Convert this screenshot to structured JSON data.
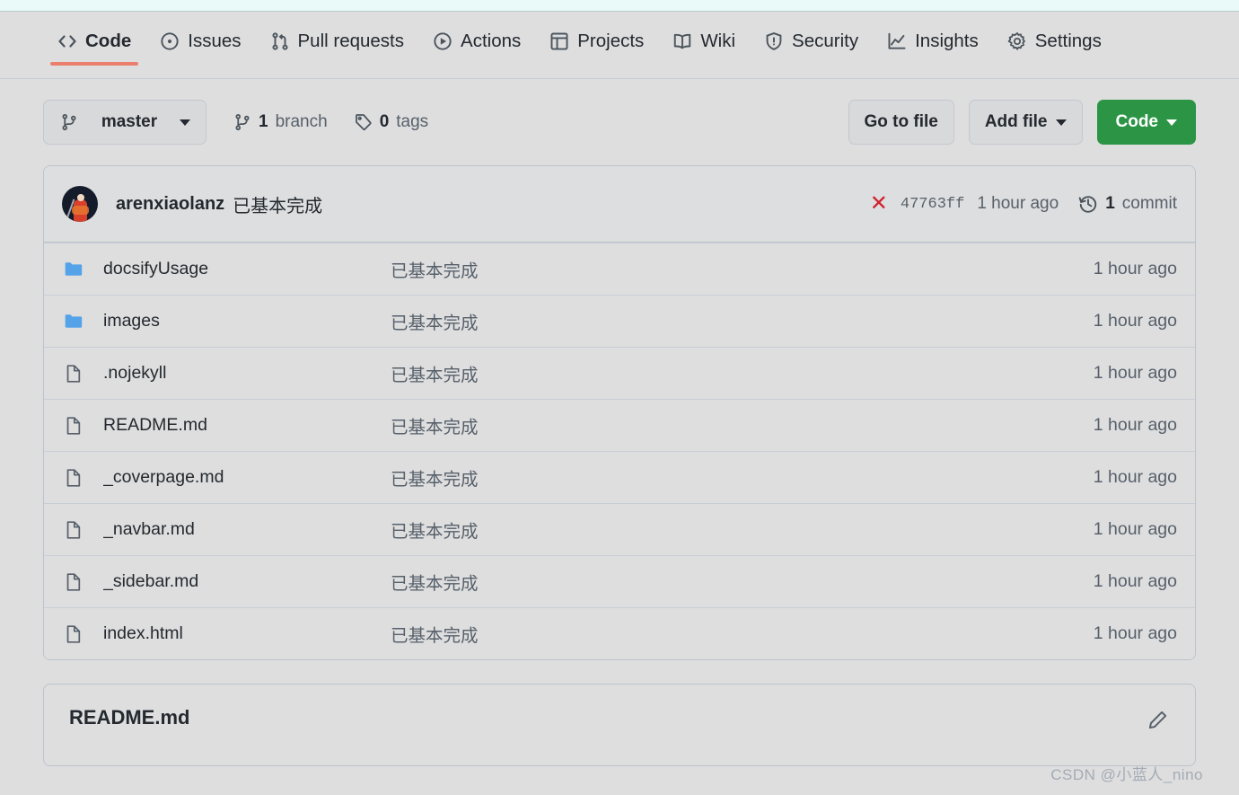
{
  "nav": {
    "items": [
      {
        "label": "Code",
        "icon": "code-icon",
        "active": true
      },
      {
        "label": "Issues",
        "icon": "issue-icon",
        "active": false
      },
      {
        "label": "Pull requests",
        "icon": "pr-icon",
        "active": false
      },
      {
        "label": "Actions",
        "icon": "play-icon",
        "active": false
      },
      {
        "label": "Projects",
        "icon": "table-icon",
        "active": false
      },
      {
        "label": "Wiki",
        "icon": "book-icon",
        "active": false
      },
      {
        "label": "Security",
        "icon": "shield-icon",
        "active": false
      },
      {
        "label": "Insights",
        "icon": "graph-icon",
        "active": false
      },
      {
        "label": "Settings",
        "icon": "gear-icon",
        "active": false
      }
    ],
    "active_underline_color": "#eb7f6c"
  },
  "branch_bar": {
    "branch_name": "master",
    "branch_count": "1",
    "branch_count_label": "branch",
    "tag_count": "0",
    "tag_count_label": "tags",
    "go_to_file_label": "Go to file",
    "add_file_label": "Add file",
    "code_label": "Code",
    "code_button_color": "#2b9545"
  },
  "commit_header": {
    "author": "arenxiaolanz",
    "message": "已基本完成",
    "status_icon": "x-failed-icon",
    "status_color": "#cf222e",
    "hash": "47763ff",
    "time": "1 hour ago",
    "commit_count": "1",
    "commit_count_label": "commit"
  },
  "files": [
    {
      "name": "docsifyUsage",
      "type": "folder",
      "commit": "已基本完成",
      "time": "1 hour ago"
    },
    {
      "name": "images",
      "type": "folder",
      "commit": "已基本完成",
      "time": "1 hour ago"
    },
    {
      "name": ".nojekyll",
      "type": "file",
      "commit": "已基本完成",
      "time": "1 hour ago"
    },
    {
      "name": "README.md",
      "type": "file",
      "commit": "已基本完成",
      "time": "1 hour ago"
    },
    {
      "name": "_coverpage.md",
      "type": "file",
      "commit": "已基本完成",
      "time": "1 hour ago"
    },
    {
      "name": "_navbar.md",
      "type": "file",
      "commit": "已基本完成",
      "time": "1 hour ago"
    },
    {
      "name": "_sidebar.md",
      "type": "file",
      "commit": "已基本完成",
      "time": "1 hour ago"
    },
    {
      "name": "index.html",
      "type": "file",
      "commit": "已基本完成",
      "time": "1 hour ago"
    }
  ],
  "readme": {
    "title": "README.md",
    "edit_icon": "pencil-icon"
  },
  "watermark": {
    "text": "CSDN @小蓝人_nino"
  },
  "colors": {
    "page_background": "#dededf",
    "folder_icon": "#54a3e8",
    "muted_text": "#57606a",
    "border": "#bcc3cb"
  }
}
